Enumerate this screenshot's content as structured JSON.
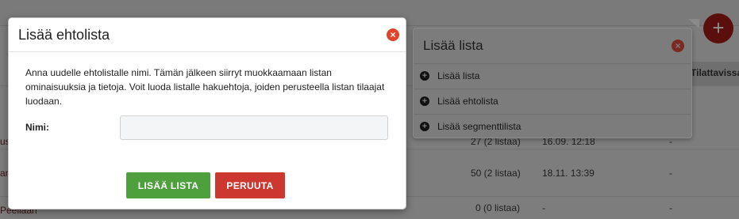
{
  "modal": {
    "title": "Lisää ehtolista",
    "close_icon": "×",
    "description": "Anna uudelle ehtolistalle nimi. Tämän jälkeen siirryt muokkaamaan listan ominaisuuksia ja tietoja. Voit luoda listalle hakuehtoja, joiden perusteella listan tilaajat luodaan.",
    "name_label": "Nimi:",
    "name_value": "",
    "add_button": "LISÄÄ LISTA",
    "cancel_button": "PERUUTA"
  },
  "popover": {
    "title": "Lisää lista",
    "close_icon": "×",
    "items": [
      {
        "icon": "+",
        "label": "Lisää lista"
      },
      {
        "icon": "+",
        "label": "Lisää ehtolista"
      },
      {
        "icon": "+",
        "label": "Lisää segmenttilista"
      }
    ]
  },
  "background": {
    "add_button_icon": "+",
    "column_header": "Tilattavissa",
    "rows": [
      {
        "count": "27 (2 listaa)",
        "date": "16.09. 12:18",
        "extra": "-"
      },
      {
        "count": "50 (2 listaa)",
        "date": "18.11. 13:39",
        "extra": "-"
      },
      {
        "count": "0 (0 listaa)",
        "date": "-",
        "extra": "-"
      }
    ],
    "left_fragments": [
      "us",
      "ari",
      "Peeilaan"
    ]
  },
  "colors": {
    "accent_green": "#4ea03c",
    "accent_red": "#cc3730",
    "close_red": "#e0452b"
  }
}
